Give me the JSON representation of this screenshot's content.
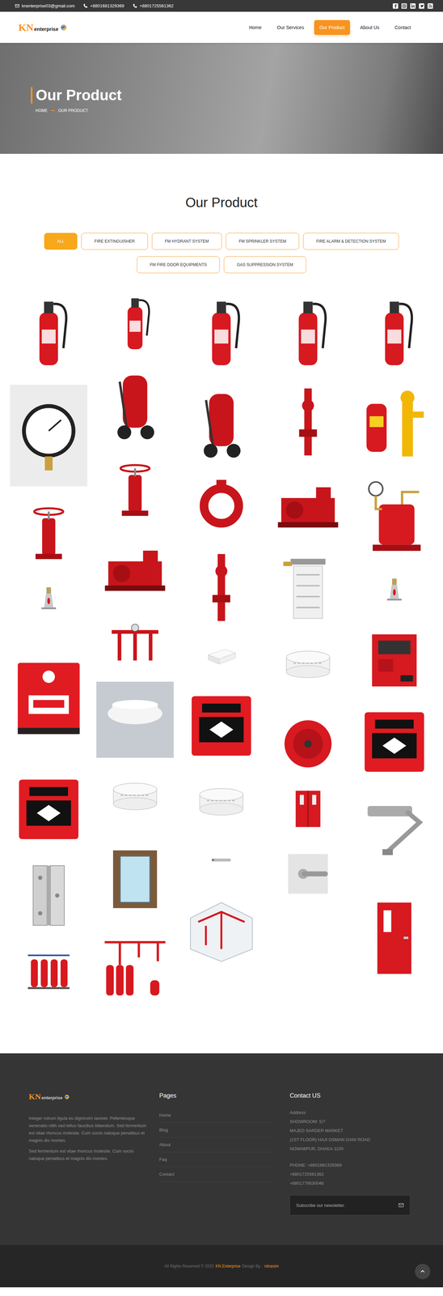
{
  "topbar": {
    "email": "knenterprise03@gmail.com",
    "phones": [
      "+8801681329369",
      "+8801725561362"
    ]
  },
  "logo": {
    "mark": "KN",
    "name": "enterprise"
  },
  "nav": [
    {
      "label": "Home",
      "selected": false
    },
    {
      "label": "Our Services",
      "selected": false
    },
    {
      "label": "Our Product",
      "selected": true
    },
    {
      "label": "About Us",
      "selected": false
    },
    {
      "label": "Contact",
      "selected": false
    }
  ],
  "hero": {
    "title": "Our Product",
    "breadcrumb": [
      "HOME",
      "OUR PRODUCT"
    ]
  },
  "section_title": "Our Product",
  "filters": [
    {
      "label": "ALL",
      "selected": true
    },
    {
      "label": "FIRE EXTINGUISHER",
      "selected": false
    },
    {
      "label": "FM HYDRANT SYSTEM",
      "selected": false
    },
    {
      "label": "FM SPRINKLER SYSTEM",
      "selected": false
    },
    {
      "label": "FIRE ALARM & DETECTION SYSTEM",
      "selected": false
    },
    {
      "label": "FM FIRE DOOR EQUIPMENTS",
      "selected": false
    },
    {
      "label": "GAS SUPPRESSION SYSTEM",
      "selected": false
    }
  ],
  "product_columns": [
    [
      {
        "kind": "extinguisher"
      },
      {
        "kind": "gauge"
      },
      {
        "kind": "valve"
      },
      {
        "kind": "sprinkler"
      },
      {
        "kind": "pull-station"
      },
      {
        "kind": "break-glass"
      },
      {
        "kind": "hinge"
      },
      {
        "kind": "cylinders"
      }
    ],
    [
      {
        "kind": "extinguisher-small"
      },
      {
        "kind": "trolley"
      },
      {
        "kind": "valve"
      },
      {
        "kind": "pump"
      },
      {
        "kind": "pipework"
      },
      {
        "kind": "smoke-detector"
      },
      {
        "kind": "detector"
      },
      {
        "kind": "glass-door"
      },
      {
        "kind": "gas-system"
      }
    ],
    [
      {
        "kind": "extinguisher"
      },
      {
        "kind": "trolley"
      },
      {
        "kind": "clamp"
      },
      {
        "kind": "riser"
      },
      {
        "kind": "box"
      },
      {
        "kind": "break-glass"
      },
      {
        "kind": "detector"
      },
      {
        "kind": "panic-bar"
      },
      {
        "kind": "diagram"
      }
    ],
    [
      {
        "kind": "extinguisher"
      },
      {
        "kind": "riser"
      },
      {
        "kind": "pump"
      },
      {
        "kind": "hose"
      },
      {
        "kind": "detector"
      },
      {
        "kind": "bell"
      },
      {
        "kind": "double-door"
      },
      {
        "kind": "handle"
      }
    ],
    [
      {
        "kind": "extinguisher"
      },
      {
        "kind": "hydrant"
      },
      {
        "kind": "alarm-valve"
      },
      {
        "kind": "sprinkler"
      },
      {
        "kind": "panel"
      },
      {
        "kind": "break-glass"
      },
      {
        "kind": "door-closer"
      },
      {
        "kind": "door"
      }
    ]
  ],
  "footer": {
    "about": [
      "Integer rutrum ligula eu dignissim laoreet. Pellentesque venenatis nibh sed tellus faucibus bibendum. Sed fermentum est vitae rhoncus molestie. Cum sociis natoque penatibus et magnis dis montes.",
      "Sed fermentum est vitae rhoncus molestie. Cum sociis natoque penatibus et magnis dis montes."
    ],
    "pages_title": "Pages",
    "pages": [
      "Home",
      "Blog",
      "About",
      "Faq",
      "Contact"
    ],
    "contact_title": "Contact US",
    "address_label": "Address",
    "address_lines": [
      "SHOWROOM: 5/7",
      "MAJED SARDER MARKET",
      "(1ST FLOOR) HAJI OSMAN GANI ROAD",
      "NOWABPUR, DHAKA-1100"
    ],
    "phone_lines": [
      "PHONE: +8801681329369",
      "+8801725561362",
      "+8801779530046"
    ],
    "newsletter_placeholder": "Subscribe our newsletter."
  },
  "copyright": {
    "prefix": "All Rights Reserved © 2020",
    "brand": "KN Enterprise",
    "middle": "Design By :",
    "author": "rdnasim"
  }
}
